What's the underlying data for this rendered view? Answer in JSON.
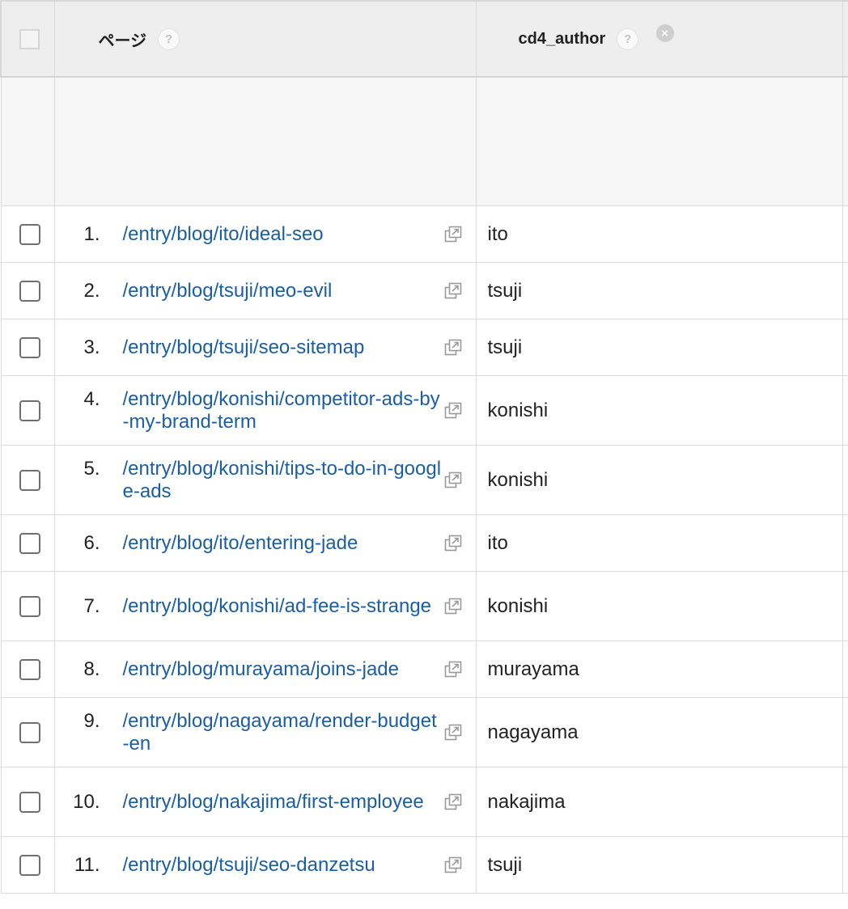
{
  "header": {
    "page_label": "ページ",
    "author_label": "cd4_author",
    "help_glyph": "?",
    "remove_glyph": "×"
  },
  "rows": [
    {
      "num": "1.",
      "page": "/entry/blog/ito/ideal-seo",
      "author": "ito"
    },
    {
      "num": "2.",
      "page": "/entry/blog/tsuji/meo-evil",
      "author": "tsuji"
    },
    {
      "num": "3.",
      "page": "/entry/blog/tsuji/seo-sitemap",
      "author": "tsuji"
    },
    {
      "num": "4.",
      "page": "/entry/blog/konishi/competitor-ads-by-my-brand-term",
      "author": "konishi"
    },
    {
      "num": "5.",
      "page": "/entry/blog/konishi/tips-to-do-in-google-ads",
      "author": "konishi"
    },
    {
      "num": "6.",
      "page": "/entry/blog/ito/entering-jade",
      "author": "ito"
    },
    {
      "num": "7.",
      "page": "/entry/blog/konishi/ad-fee-is-strange",
      "author": "konishi"
    },
    {
      "num": "8.",
      "page": "/entry/blog/murayama/joins-jade",
      "author": "murayama"
    },
    {
      "num": "9.",
      "page": "/entry/blog/nagayama/render-budget-en",
      "author": "nagayama"
    },
    {
      "num": "10.",
      "page": "/entry/blog/nakajima/first-employee",
      "author": "nakajima"
    },
    {
      "num": "11.",
      "page": "/entry/blog/tsuji/seo-danzetsu",
      "author": "tsuji"
    }
  ],
  "colors": {
    "link": "#1a5fa4",
    "header_bg": "#eeeeee",
    "border": "#dcdcdc"
  },
  "icons": {
    "help": "help-icon",
    "remove": "remove-dimension-icon",
    "external": "external-link-icon"
  }
}
